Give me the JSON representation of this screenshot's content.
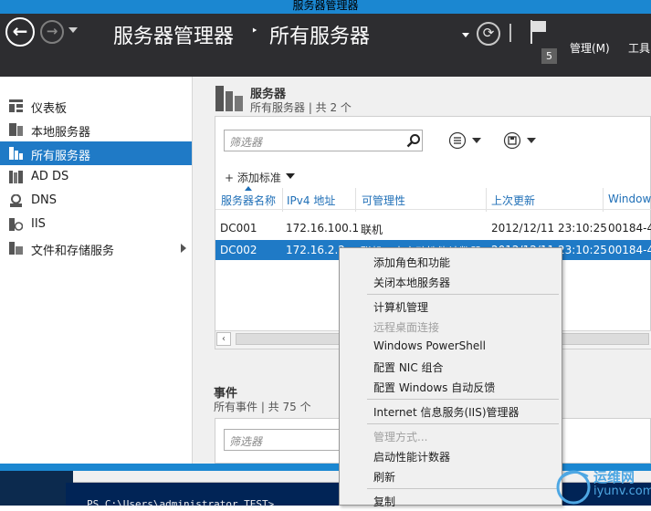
{
  "window": {
    "title": "服务器管理器"
  },
  "header": {
    "breadcrumb_root": "服务器管理器",
    "breadcrumb_separator": "‣",
    "breadcrumb_page": "所有服务器",
    "notification_count": "5",
    "menu_manage": "管理(M)",
    "menu_tools": "工具",
    "icons": [
      "back-arrow-icon",
      "forward-arrow-icon",
      "refresh-icon",
      "flag-icon"
    ]
  },
  "sidebar": {
    "items": [
      {
        "label": "仪表板",
        "icon": "dashboard-icon"
      },
      {
        "label": "本地服务器",
        "icon": "local-server-icon"
      },
      {
        "label": "所有服务器",
        "icon": "all-servers-icon",
        "selected": true
      },
      {
        "label": "AD DS",
        "icon": "ad-ds-icon"
      },
      {
        "label": "DNS",
        "icon": "dns-icon"
      },
      {
        "label": "IIS",
        "icon": "iis-icon"
      },
      {
        "label": "文件和存储服务",
        "icon": "file-storage-icon",
        "has_submenu": true
      }
    ]
  },
  "servers": {
    "title": "服务器",
    "subtitle": "所有服务器 | 共 2 个",
    "filter_placeholder": "筛选器",
    "add_criteria": "+ 添加标准",
    "columns": [
      "服务器名称",
      "IPv4 地址",
      "可管理性",
      "上次更新",
      "Window"
    ],
    "rows": [
      {
        "name": "DC001",
        "ip": "172.16.100.1",
        "manageability": "联机",
        "last_update": "2012/12/11 23:10:25",
        "windows": "00184-4"
      },
      {
        "name": "DC002",
        "ip": "172.16.2.2",
        "manageability": "联机 - 未启动性能计数器",
        "last_update": "2012/12/11 23:10:25",
        "windows": "00184-4",
        "selected": true
      }
    ]
  },
  "events": {
    "title": "事件",
    "subtitle": "所有事件 | 共 75 个",
    "filter_placeholder": "筛选器"
  },
  "context_menu": {
    "items": [
      {
        "label": "添加角色和功能",
        "enabled": true
      },
      {
        "label": "关闭本地服务器",
        "enabled": true
      },
      {
        "separator": true
      },
      {
        "label": "计算机管理",
        "enabled": true
      },
      {
        "label": "远程桌面连接",
        "enabled": false
      },
      {
        "label": "Windows PowerShell",
        "enabled": true
      },
      {
        "label": "配置 NIC 组合",
        "enabled": true
      },
      {
        "label": "配置 Windows 自动反馈",
        "enabled": true
      },
      {
        "separator": true
      },
      {
        "label": "Internet 信息服务(IIS)管理器",
        "enabled": true
      },
      {
        "separator": true
      },
      {
        "label": "管理方式...",
        "enabled": false
      },
      {
        "label": "启动性能计数器",
        "enabled": true
      },
      {
        "label": "刷新",
        "enabled": true
      },
      {
        "separator": true
      },
      {
        "label": "复制",
        "enabled": true
      }
    ]
  },
  "background_window": {
    "console_text": "PS C:\\Users\\administrator.TEST>"
  },
  "watermark": {
    "text_cn": "运维网",
    "text_url": "iyunv.com"
  },
  "colors": {
    "header_bg": "#2d2d30",
    "accent": "#1f7ac6",
    "title_bar": "#1b87d1",
    "link": "#1f6fb7"
  }
}
